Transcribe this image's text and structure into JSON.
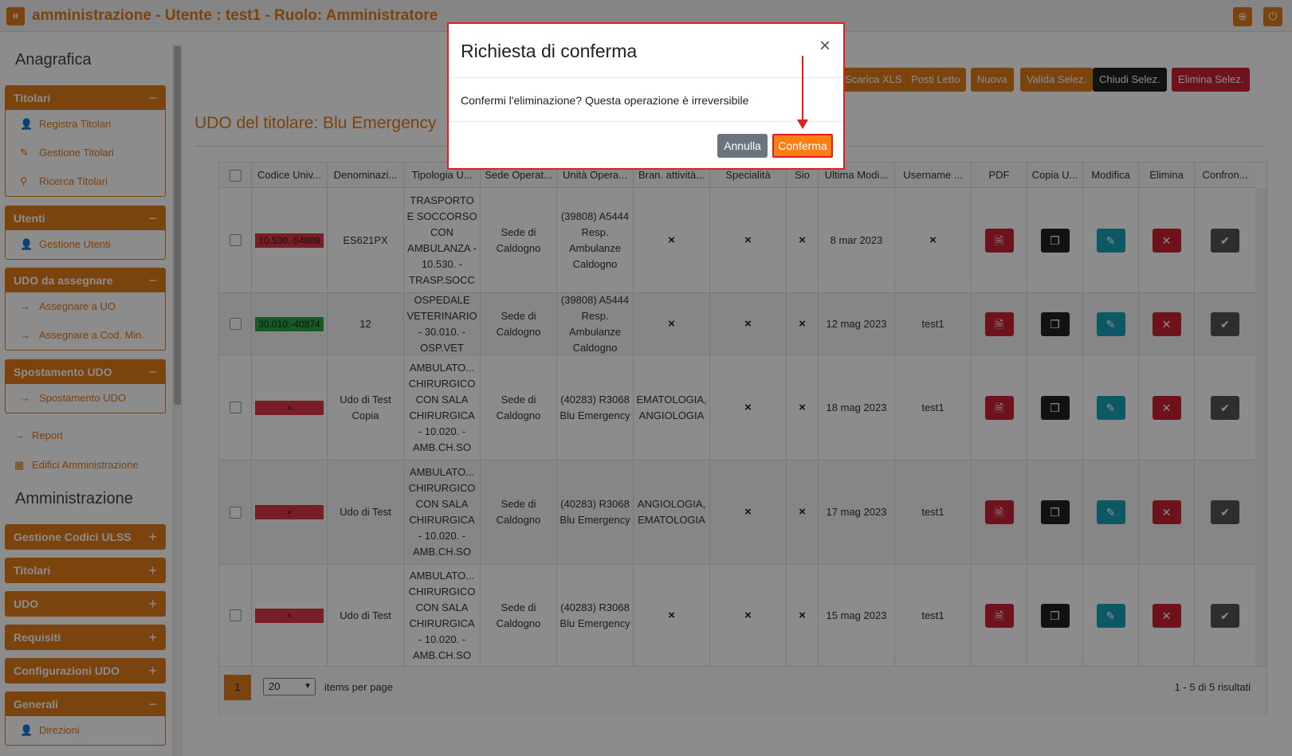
{
  "topbar": {
    "title": "amministrazione - Utente : test1 - Ruolo: Amministratore",
    "back_icon": "double-chevron-left-icon",
    "globe_icon": "globe-icon",
    "power_icon": "power-icon"
  },
  "sidebar": {
    "heading_anagrafica": "Anagrafica",
    "heading_amministrazione": "Amministrazione",
    "panel_titolari": {
      "title": "Titolari",
      "toggle": "−",
      "items": [
        "Registra Titolari",
        "Gestione Titolari",
        "Ricerca Titolari"
      ]
    },
    "panel_utenti": {
      "title": "Utenti",
      "toggle": "−",
      "items": [
        "Gestione Utenti"
      ]
    },
    "panel_udo_assegnare": {
      "title": "UDO da assegnare",
      "toggle": "−",
      "items": [
        "Assegnare a UO",
        "Assegnare a Cod. Min."
      ]
    },
    "panel_spostamento": {
      "title": "Spostamento UDO",
      "toggle": "−",
      "items": [
        "Spostamento UDO"
      ]
    },
    "report": "Report",
    "edifici": "Edifici Amministrazione",
    "admin_panels": [
      {
        "title": "Gestione Codici ULSS",
        "toggle": "+"
      },
      {
        "title": "Titolari",
        "toggle": "+"
      },
      {
        "title": "UDO",
        "toggle": "+"
      },
      {
        "title": "Requisiti",
        "toggle": "+"
      },
      {
        "title": "Configurazioni UDO",
        "toggle": "+"
      }
    ],
    "panel_generali": {
      "title": "Generali",
      "toggle": "−",
      "items": [
        "Direzioni"
      ]
    }
  },
  "actions": {
    "scarica_xls": "Scarica XLS",
    "posti_letto": "Posti Letto",
    "nuova": "Nuova",
    "valida": "Valida Selez.",
    "chiudi": "Chiudi Selez.",
    "elimina": "Elimina Selez."
  },
  "page_title": "UDO del titolare: Blu Emergency",
  "table": {
    "headers": [
      "Codice Univ...",
      "Denominazi...",
      "Tipologia U...",
      "Sede Operat...",
      "Unità Opera...",
      "Bran. attività...",
      "Specialità",
      "Sio",
      "Ultima Modi...",
      "Username ...",
      "PDF",
      "Copia U...",
      "Modifica",
      "Elimina",
      "Confron..."
    ],
    "rows": [
      {
        "code": "10.530.-54808",
        "code_color": "#dc3545",
        "denom": "ES621PX",
        "tipologia": "TRASPORTO E SOCCORSO CON AMBULANZA - 10.530. - TRASP.SOCC",
        "sede": "Sede di Caldogno",
        "unita": "(39808) A5444 Resp. Ambulanze Caldogno",
        "branca": "×",
        "spec": "×",
        "sio": "×",
        "ultima": "8 mar 2023",
        "username": "×"
      },
      {
        "code": "30.010.-40874",
        "code_color": "#28a745",
        "denom": "12",
        "tipologia": "OSPEDALE VETERINARIO - 30.010. - OSP.VET",
        "sede": "Sede di Caldogno",
        "unita": "(39808) A5444 Resp. Ambulanze Caldogno",
        "branca": "×",
        "spec": "×",
        "sio": "×",
        "ultima": "12 mag 2023",
        "username": "test1"
      },
      {
        "code": "×",
        "code_color": "#dc3545",
        "denom": "Udo di Test Copia",
        "tipologia": "AMBULATO... CHIRURGICO CON SALA CHIRURGICA - 10.020. - AMB.CH.SO",
        "sede": "Sede di Caldogno",
        "unita": "(40283) R3068 Blu Emergency",
        "branca": "EMATOLOGIA, ANGIOLOGIA",
        "spec": "×",
        "sio": "×",
        "ultima": "18 mag 2023",
        "username": "test1"
      },
      {
        "code": "×",
        "code_color": "#dc3545",
        "denom": "Udo di Test",
        "tipologia": "AMBULATO... CHIRURGICO CON SALA CHIRURGICA - 10.020. - AMB.CH.SO",
        "sede": "Sede di Caldogno",
        "unita": "(40283) R3068 Blu Emergency",
        "branca": "ANGIOLOGIA, EMATOLOGIA",
        "spec": "×",
        "sio": "×",
        "ultima": "17 mag 2023",
        "username": "test1"
      },
      {
        "code": "×",
        "code_color": "#dc3545",
        "denom": "Udo di Test",
        "tipologia": "AMBULATO... CHIRURGICO CON SALA CHIRURGICA - 10.020. - AMB.CH.SO",
        "sede": "Sede di Caldogno",
        "unita": "(40283) R3068 Blu Emergency",
        "branca": "×",
        "spec": "×",
        "sio": "×",
        "ultima": "15 mag 2023",
        "username": "test1"
      }
    ]
  },
  "pager": {
    "page": "1",
    "per_page": "20",
    "items_per_page": "items per page",
    "results": "1 - 5 di 5 risultati"
  },
  "modal": {
    "title": "Richiesta di conferma",
    "close": "×",
    "body": "Confermi l'eliminazione? Questa operazione è irreversibile",
    "annulla": "Annulla",
    "conferma": "Conferma"
  },
  "colors": {
    "accent": "#e07b1a",
    "danger": "#c82333",
    "info": "#17a2b8",
    "dark": "#222222",
    "annotation": "#e02020"
  }
}
